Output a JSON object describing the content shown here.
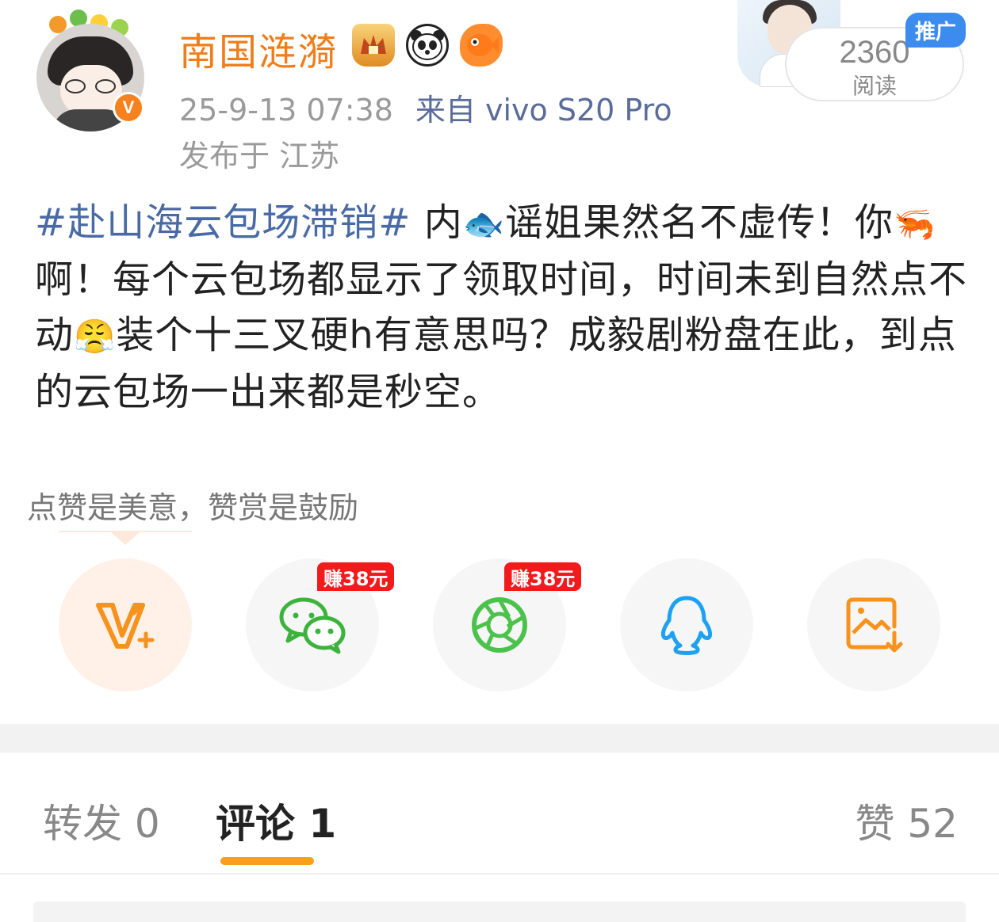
{
  "author": {
    "name": "南国涟漪",
    "verified_mark": "V",
    "badges": [
      "crown-badge-icon",
      "panda-badge-icon",
      "fish-badge-icon"
    ]
  },
  "post_meta": {
    "time": "25-9-13 07:38",
    "source": "来自 vivo S20 Pro",
    "location": "发布于 江苏"
  },
  "promo": {
    "tag": "推广",
    "read_count": "2360",
    "read_label": "阅读"
  },
  "post": {
    "hashtag": "#赴山海云包场滞销#",
    "seg1": " 内",
    "seg2": "谣姐果然名不虚传！你",
    "seg3": "啊！每个云包场都显示了领取时间，时间未到自然点不动",
    "seg4": "装个十三叉硬h有意思吗？成毅剧粉盘在此，到点的云包场一出来都是秒空。",
    "emojis": {
      "fish": "🐟",
      "shrimp": "🦐",
      "angry": "😤"
    }
  },
  "reward_tip": "点赞是美意，赞赏是鼓励",
  "share": {
    "earn_label_1": "赚38元",
    "earn_label_2": "赚38元",
    "items": [
      "vplus-icon",
      "wechat-icon",
      "moments-icon",
      "qq-icon",
      "save-image-icon"
    ]
  },
  "tabs": {
    "repost": "转发 0",
    "comment": "评论 1",
    "like": "赞 52"
  },
  "colors": {
    "username": "#f07d1a",
    "hashtag": "#4a6aa6",
    "accent": "#f7a01a",
    "earn_tag": "#f21a1a",
    "promo_tag": "#3c8cf0"
  }
}
